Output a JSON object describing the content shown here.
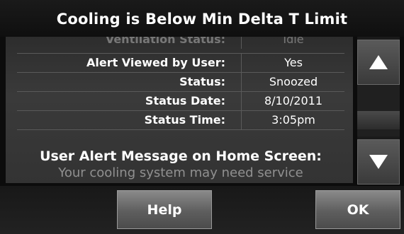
{
  "title": "Cooling is Below Min Delta T Limit",
  "details": [
    {
      "label": "Ventilation Status:",
      "value": "Idle"
    },
    {
      "label": "Alert Viewed by User:",
      "value": "Yes"
    },
    {
      "label": "Status:",
      "value": "Snoozed"
    },
    {
      "label": "Status Date:",
      "value": "8/10/2011"
    },
    {
      "label": "Status Time:",
      "value": "3:05pm"
    }
  ],
  "message": {
    "title": "User Alert Message on Home Screen:",
    "body": "Your cooling system may need service"
  },
  "scroll": {
    "up_icon": "triangle-up",
    "down_icon": "triangle-down",
    "position": 0.6
  },
  "buttons": {
    "help": "Help",
    "ok": "OK"
  },
  "colors": {
    "background": "#0c0c0c",
    "button": "#6e6e6e",
    "text": "#ffffff"
  }
}
